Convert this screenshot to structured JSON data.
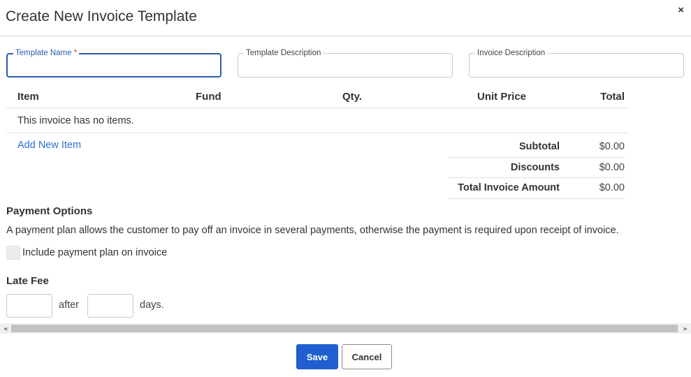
{
  "modal": {
    "title": "Create New Invoice Template",
    "close_icon": "×"
  },
  "fields": {
    "template_name": {
      "label": "Template Name",
      "required_mark": "*",
      "value": ""
    },
    "template_description": {
      "label": "Template Description",
      "value": ""
    },
    "invoice_description": {
      "label": "Invoice Description",
      "value": ""
    }
  },
  "items_table": {
    "columns": [
      "Item",
      "Fund",
      "Qty.",
      "Unit Price",
      "Total"
    ],
    "empty_message": "This invoice has no items.",
    "add_item_label": "Add New Item"
  },
  "totals": {
    "subtotal": {
      "label": "Subtotal",
      "value": "$0.00"
    },
    "discounts": {
      "label": "Discounts",
      "value": "$0.00"
    },
    "total": {
      "label": "Total Invoice Amount",
      "value": "$0.00"
    }
  },
  "payment_options": {
    "title": "Payment Options",
    "description": "A payment plan allows the customer to pay off an invoice in several payments, otherwise the payment is required upon receipt of invoice.",
    "checkbox_label": "Include payment plan on invoice",
    "checked": false
  },
  "late_fee": {
    "title": "Late Fee",
    "amount_value": "",
    "after_text": "after",
    "days_value": "",
    "days_text": "days."
  },
  "buttons": {
    "save": "Save",
    "cancel": "Cancel"
  },
  "colors": {
    "primary": "#1f5fcf",
    "link": "#2a6fcf",
    "focus_border": "#2a5ea8",
    "required": "#d03030"
  }
}
